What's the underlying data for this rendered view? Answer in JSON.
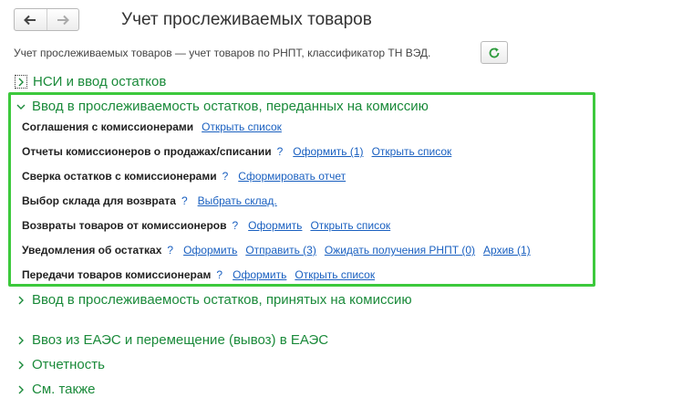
{
  "window": {
    "title": "Учет прослеживаемых товаров"
  },
  "toolbar": {
    "back_icon": "arrow-left-icon",
    "forward_icon": "arrow-right-icon",
    "refresh_icon": "refresh-icon"
  },
  "description": "Учет прослеживаемых товаров — учет товаров по РНПТ, классификатор ТН ВЭД.",
  "sections": {
    "nsi": {
      "label": "НСИ и ввод остатков"
    },
    "commission_out": {
      "label": "Ввод в прослеживаемость остатков, переданных на комиссию",
      "rows": [
        {
          "label": "Соглашения с комиссионерами",
          "help": "",
          "links": [
            "Открыть список"
          ]
        },
        {
          "label": "Отчеты комиссионеров о продажах/списании",
          "help": "?",
          "links": [
            "Оформить (1)",
            "Открыть список"
          ]
        },
        {
          "label": "Сверка остатков с комиссионерами",
          "help": "?",
          "links": [
            "Сформировать отчет"
          ]
        },
        {
          "label": "Выбор склада для возврата",
          "help": "?",
          "links": [
            "Выбрать склад."
          ]
        },
        {
          "label": "Возвраты товаров от комиссионеров",
          "help": "?",
          "links": [
            "Оформить",
            "Открыть список"
          ]
        },
        {
          "label": "Уведомления об остатках",
          "help": "?",
          "links": [
            "Оформить",
            "Отправить (3)",
            "Ожидать получения РНПТ (0)",
            "Архив (1)"
          ]
        },
        {
          "label": "Передачи товаров комиссионерам",
          "help": "?",
          "links": [
            "Оформить",
            "Открыть список"
          ]
        }
      ]
    },
    "commission_in": {
      "label": "Ввод в прослеживаемость остатков, принятых на комиссию"
    },
    "eaeu": {
      "label": "Ввоз из ЕАЭС и перемещение (вывоз) в ЕАЭС"
    },
    "reports": {
      "label": "Отчетность"
    },
    "see_also": {
      "label": "См. также"
    }
  },
  "colors": {
    "accent_green": "#1a8a3a",
    "highlight_border": "#3cc93c",
    "link_blue": "#1a60c0"
  }
}
